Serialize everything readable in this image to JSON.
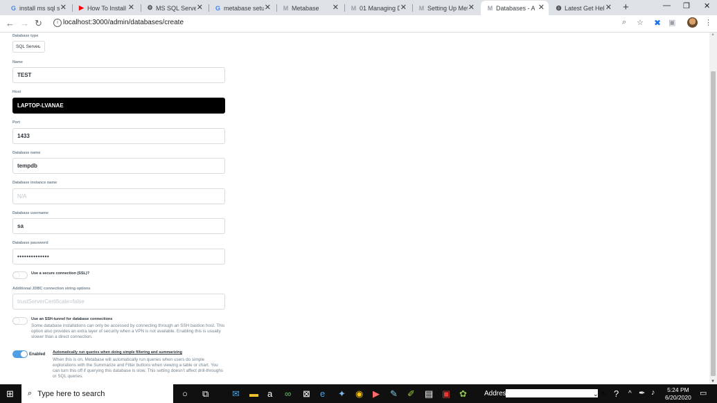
{
  "browser": {
    "tabs": [
      {
        "title": "install ms sql ser",
        "icon": "google-icon"
      },
      {
        "title": "How To Install S",
        "icon": "youtube-icon"
      },
      {
        "title": "MS SQL Server",
        "icon": "metabase-icon"
      },
      {
        "title": "metabase setup",
        "icon": "google-icon"
      },
      {
        "title": "Metabase",
        "icon": "gmail-icon"
      },
      {
        "title": "01 Managing Da",
        "icon": "gmail-icon"
      },
      {
        "title": "Setting Up Meta",
        "icon": "gmail-icon"
      },
      {
        "title": "Databases - Adm",
        "icon": "gmail-icon"
      },
      {
        "title": "Latest Get Help",
        "icon": "globe-icon"
      }
    ],
    "active_tab_index": 7,
    "url": "localhost:3000/admin/databases/create"
  },
  "form": {
    "db_type_label": "Database type",
    "db_type_value": "SQL Server",
    "name_label": "Name",
    "name_value": "TEST",
    "host_label": "Host",
    "host_value": "LAPTOP-LVANAE",
    "port_label": "Port",
    "port_value": "1433",
    "dbname_label": "Database name",
    "dbname_value": "tempdb",
    "instance_label": "Database instance name",
    "instance_placeholder": "N/A",
    "username_label": "Database username",
    "username_value": "sa",
    "password_label": "Database password",
    "password_value": "••••••••••••••",
    "ssl_label": "Use a secure connection (SSL)?",
    "ssl_on": false,
    "jdbc_label": "Additional JDBC connection string options",
    "jdbc_placeholder": "trustServerCertificate=false",
    "ssh_title": "Use an SSH-tunnel for database connections",
    "ssh_desc": "Some database installations can only be accessed by connecting through an SSH bastion host. This option also provides an extra layer of security when a VPN is not available. Enabling this is usually slower than a direct connection.",
    "ssh_on": false,
    "auto_run_status": "Enabled",
    "auto_run_title": "Automatically run queries when doing simple filtering and summarizing",
    "auto_run_desc": "When this is on, Metabase will automatically run queries when users do simple explorations with the Summarize and Filter buttons when viewing a table or chart. You can turn this off if querying this database is slow. This setting doesn’t affect drill-throughs or SQL queries.",
    "auto_run_on": true
  },
  "taskbar": {
    "search_placeholder": "Type here to search",
    "address_label": "Address",
    "time": "5:24 PM",
    "date": "6/20/2020"
  }
}
